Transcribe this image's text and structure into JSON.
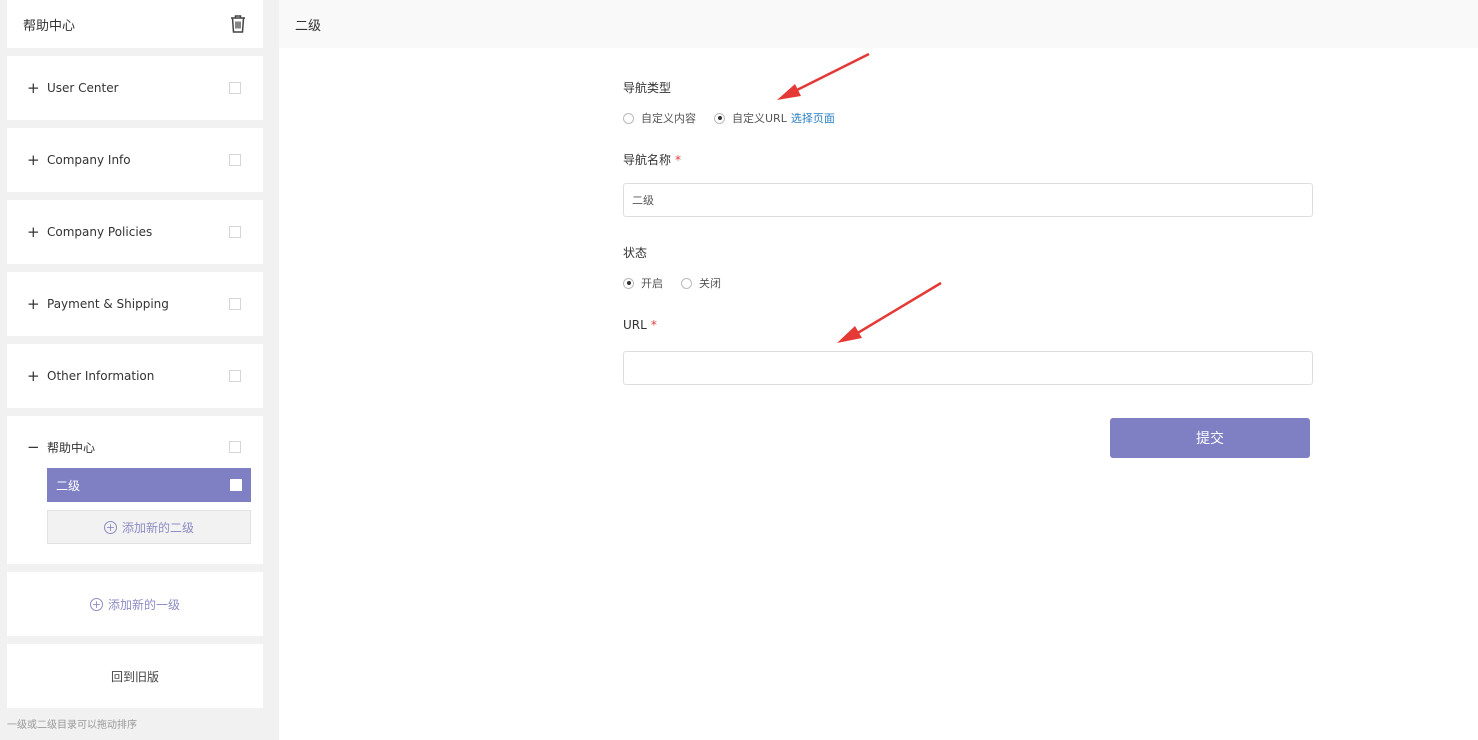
{
  "sidebar": {
    "header_title": "帮助中心",
    "items": [
      {
        "sign": "+",
        "label": "User Center"
      },
      {
        "sign": "+",
        "label": "Company Info"
      },
      {
        "sign": "+",
        "label": "Company Policies"
      },
      {
        "sign": "+",
        "label": "Payment & Shipping"
      },
      {
        "sign": "+",
        "label": "Other Information"
      }
    ],
    "expanded": {
      "sign": "−",
      "label": "帮助中心",
      "active_sub": "二级",
      "add_sub_label": "添加新的二级"
    },
    "add_top_label": "添加新的一级",
    "back_old_label": "回到旧版",
    "hint": "一级或二级目录可以拖动排序"
  },
  "main": {
    "header_title": "二级",
    "nav_type": {
      "label": "导航类型",
      "options": [
        "自定义内容",
        "自定义URL"
      ],
      "selected": 1,
      "link": "选择页面"
    },
    "nav_name": {
      "label": "导航名称",
      "required_mark": "*",
      "value": "二级"
    },
    "status": {
      "label": "状态",
      "options": [
        "开启",
        "关闭"
      ],
      "selected": 0
    },
    "url": {
      "label": "URL",
      "required_mark": "*",
      "value": ""
    },
    "submit_label": "提交"
  },
  "colors": {
    "accent": "#7f7fc4",
    "link": "#2a7fc0",
    "required": "#e54040",
    "arrow": "#e53935"
  }
}
